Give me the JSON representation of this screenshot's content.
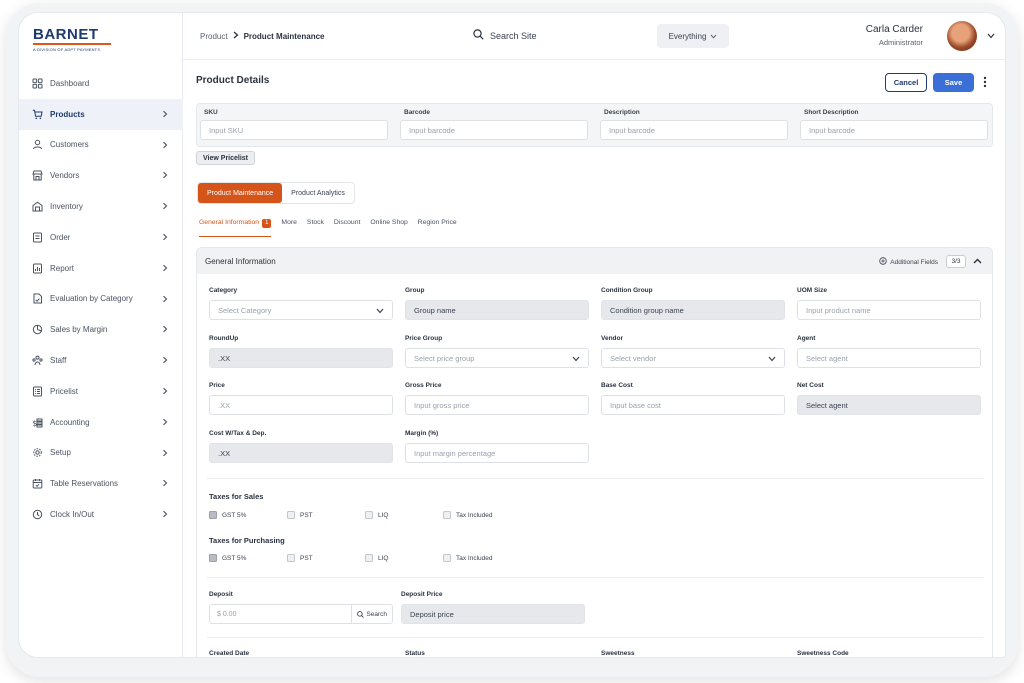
{
  "brand": {
    "name": "BARNET",
    "tagline": "A DIVISION OF ADPT PAYMENTS",
    "primary_color": "#1e3a6e",
    "accent_color": "#d4541a"
  },
  "sidebar": {
    "items": [
      {
        "label": "Dashboard",
        "icon": "dashboard-icon",
        "chevron": false
      },
      {
        "label": "Products",
        "icon": "cart-icon",
        "chevron": true,
        "active": true
      },
      {
        "label": "Customers",
        "icon": "user-icon",
        "chevron": true
      },
      {
        "label": "Vendors",
        "icon": "store-icon",
        "chevron": true
      },
      {
        "label": "Inventory",
        "icon": "warehouse-icon",
        "chevron": true
      },
      {
        "label": "Order",
        "icon": "order-icon",
        "chevron": true
      },
      {
        "label": "Report",
        "icon": "report-icon",
        "chevron": true
      },
      {
        "label": "Evaluation by Category",
        "icon": "evaluation-icon",
        "chevron": true
      },
      {
        "label": "Sales by Margin",
        "icon": "pie-icon",
        "chevron": true
      },
      {
        "label": "Staff",
        "icon": "staff-icon",
        "chevron": true
      },
      {
        "label": "Pricelist",
        "icon": "pricelist-icon",
        "chevron": true
      },
      {
        "label": "Accounting",
        "icon": "accounting-icon",
        "chevron": true
      },
      {
        "label": "Setup",
        "icon": "gear-icon",
        "chevron": true
      },
      {
        "label": "Table Reservations",
        "icon": "calendar-icon",
        "chevron": true
      },
      {
        "label": "Clock In/Out",
        "icon": "clock-icon",
        "chevron": true
      }
    ]
  },
  "header": {
    "breadcrumb_parent": "Product",
    "breadcrumb_current": "Product Maintenance",
    "search_label": "Search Site",
    "filter_label": "Everything",
    "user_name": "Carla Carder",
    "user_role": "Administrator"
  },
  "main": {
    "title": "Product Details",
    "cancel_label": "Cancel",
    "save_label": "Save",
    "top_fields": [
      {
        "label": "SKU",
        "placeholder": "Input SKU"
      },
      {
        "label": "Barcode",
        "placeholder": "Input barcode"
      },
      {
        "label": "Description",
        "placeholder": "Input barcode"
      },
      {
        "label": "Short Description",
        "placeholder": "Input barcode"
      }
    ],
    "view_pricelist_label": "View Pricelist",
    "segments": [
      "Product Maintenance",
      "Product Analytics"
    ],
    "tabs": [
      {
        "label": "General Information",
        "badge": "1"
      },
      {
        "label": "More"
      },
      {
        "label": "Stock"
      },
      {
        "label": "Discount"
      },
      {
        "label": "Online Shop"
      },
      {
        "label": "Region Price"
      }
    ],
    "panel": {
      "title": "General Information",
      "additional_fields_label": "Additional Fields",
      "count": "3/3",
      "fields": [
        {
          "label": "Category",
          "value": "Select Category",
          "type": "select"
        },
        {
          "label": "Group",
          "value": "Group name",
          "type": "readonly"
        },
        {
          "label": "Condition Group",
          "value": "Condition group name",
          "type": "readonly"
        },
        {
          "label": "UOM Size",
          "value": "Input product name",
          "type": "input"
        },
        {
          "label": "RoundUp",
          "value": ".XX",
          "type": "readonly"
        },
        {
          "label": "Price Group",
          "value": "Select price group",
          "type": "select"
        },
        {
          "label": "Vendor",
          "value": "Select vendor",
          "type": "select"
        },
        {
          "label": "Agent",
          "value": "Select agent",
          "type": "input"
        },
        {
          "label": "Price",
          "value": ".XX",
          "type": "input"
        },
        {
          "label": "Gross Price",
          "value": "Input gross price",
          "type": "input"
        },
        {
          "label": "Base Cost",
          "value": "Input base cost",
          "type": "input"
        },
        {
          "label": "Net Cost",
          "value": "Select agent",
          "type": "readonly"
        },
        {
          "label": "Cost W/Tax & Dep.",
          "value": ".XX",
          "type": "readonly"
        },
        {
          "label": "Margin (%)",
          "value": "Input margin percentage",
          "type": "input"
        }
      ],
      "taxes_sales_title": "Taxes for Sales",
      "taxes_purchasing_title": "Taxes for Purchasing",
      "tax_options": [
        {
          "label": "GST 5%",
          "checked": true
        },
        {
          "label": "PST",
          "checked": false
        },
        {
          "label": "LIQ",
          "checked": false
        },
        {
          "label": "Tax Included",
          "checked": false
        }
      ],
      "deposit_label": "Deposit",
      "deposit_value": "$ 0.00",
      "deposit_search_label": "Search",
      "deposit_price_label": "Deposit Price",
      "deposit_price_value": "Deposit price",
      "bottom_labels": [
        "Created Date",
        "Status",
        "Sweetness",
        "Sweetness Code"
      ]
    }
  }
}
